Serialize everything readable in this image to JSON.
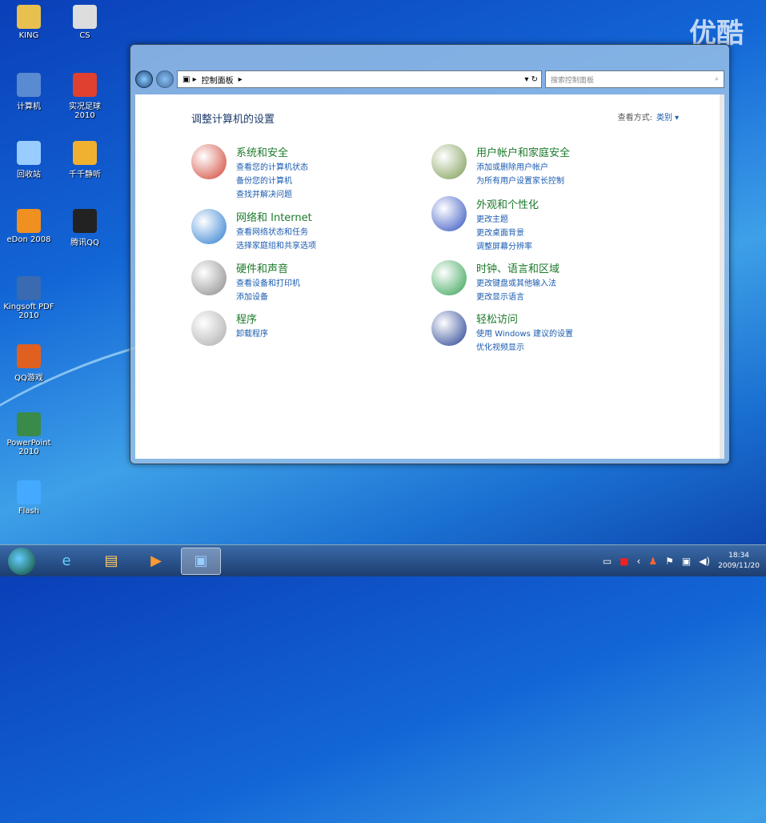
{
  "watermark": "优酷",
  "desktop_icons": [
    {
      "label": "KING",
      "color": "#e8c050"
    },
    {
      "label": "CS",
      "color": "#ddd"
    },
    {
      "label": "计算机",
      "color": "#5a8ad0"
    },
    {
      "label": "实况足球 2010",
      "color": "#e04030"
    },
    {
      "label": "回收站",
      "color": "#9cf"
    },
    {
      "label": "千千静听",
      "color": "#f0b030"
    },
    {
      "label": "eDon 2008",
      "color": "#f09020"
    },
    {
      "label": "腾讯QQ",
      "color": "#222"
    },
    {
      "label": "Kingsoft PDF 2010",
      "color": "#3a6ab0"
    },
    {
      "label": "QQ游戏",
      "color": "#e06020"
    },
    {
      "label": "PowerPoint 2010",
      "color": "#3a8a4a"
    },
    {
      "label": "Flash",
      "color": "#4af"
    }
  ],
  "window": {
    "address": "控制面板",
    "search_placeholder": "搜索控制面板",
    "title": "调整计算机的设置",
    "view_by_label": "查看方式:",
    "view_by_value": "类别 ▾",
    "categories": [
      {
        "title": "系统和安全",
        "links": [
          "查看您的计算机状态",
          "备份您的计算机",
          "查找并解决问题"
        ],
        "color": "#d04030"
      },
      {
        "title": "网络和 Internet",
        "links": [
          "查看网络状态和任务",
          "选择家庭组和共享选项"
        ],
        "color": "#2a7ad0"
      },
      {
        "title": "硬件和声音",
        "links": [
          "查看设备和打印机",
          "添加设备"
        ],
        "color": "#888"
      },
      {
        "title": "程序",
        "links": [
          "卸载程序"
        ],
        "color": "#aaa"
      },
      {
        "title": "用户帐户和家庭安全",
        "links": [
          "添加或删除用户帐户",
          "为所有用户设置家长控制"
        ],
        "color": "#7a9a50"
      },
      {
        "title": "外观和个性化",
        "links": [
          "更改主题",
          "更改桌面背景",
          "调整屏幕分辨率"
        ],
        "color": "#3050c0"
      },
      {
        "title": "时钟、语言和区域",
        "links": [
          "更改键盘或其他输入法",
          "更改显示语言"
        ],
        "color": "#30a050"
      },
      {
        "title": "轻松访问",
        "links": [
          "使用 Windows 建议的设置",
          "优化视频显示"
        ],
        "color": "#203c90"
      }
    ]
  },
  "taskbar": {
    "time": "18:34",
    "date": "2009/11/20"
  }
}
